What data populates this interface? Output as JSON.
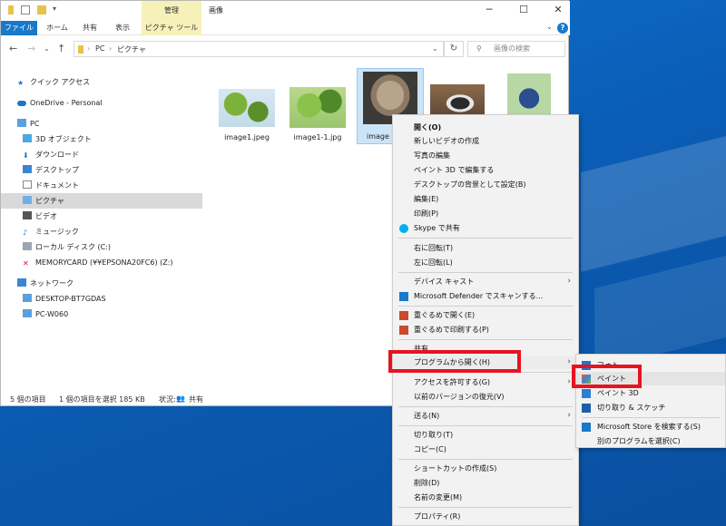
{
  "window": {
    "title": "画像",
    "manage_tab": "管理",
    "picture_tools_tab": "ピクチャ ツール",
    "ribbon_tabs": [
      "ファイル",
      "ホーム",
      "共有",
      "表示"
    ],
    "minimize": "─",
    "maximize": "☐",
    "close": "✕",
    "help": "?"
  },
  "address": {
    "breadcrumbs": [
      "PC",
      "ピクチャ"
    ],
    "search_placeholder": "画像の検索"
  },
  "nav": {
    "quick_access": "クイック アクセス",
    "onedrive": "OneDrive - Personal",
    "pc": "PC",
    "objects3d": "3D オブジェクト",
    "downloads": "ダウンロード",
    "desktop": "デスクトップ",
    "documents": "ドキュメント",
    "pictures": "ピクチャ",
    "videos": "ビデオ",
    "music": "ミュージック",
    "local_disk": "ローカル ディスク (C:)",
    "memorycard": "MEMORYCARD (¥¥EPSONA20FC6) (Z:)",
    "network": "ネットワーク",
    "desktop_pc": "DESKTOP-BT7GDAS",
    "pc_w060": "PC-W060"
  },
  "files": [
    {
      "name": "image1.jpeg"
    },
    {
      "name": "image1-1.jpg"
    },
    {
      "name": "image"
    }
  ],
  "status": {
    "count": "5 個の項目",
    "selected": "1 個の項目を選択  185 KB",
    "state": "状況:",
    "shared": "共有"
  },
  "context_menu": {
    "open": "開く(O)",
    "new_video": "新しいビデオの作成",
    "edit_photo": "写真の編集",
    "paint3d": "ペイント 3D で編集する",
    "set_background": "デスクトップの背景として設定(B)",
    "edit": "編集(E)",
    "print": "印刷(P)",
    "skype": "Skype で共有",
    "rotate_right": "右に回転(T)",
    "rotate_left": "左に回転(L)",
    "cast": "デバイス キャスト",
    "defender": "Microsoft Defender でスキャンする...",
    "gurumeru_open": "重ぐるめで開く(E)",
    "gurumeru_print": "重ぐるめで印刷する(P)",
    "share": "共有",
    "open_with": "プログラムから開く(H)",
    "grant_access": "アクセスを許可する(G)",
    "restore": "以前のバージョンの復元(V)",
    "send_to": "送る(N)",
    "cut": "切り取り(T)",
    "copy": "コピー(C)",
    "create_shortcut": "ショートカットの作成(S)",
    "delete": "削除(D)",
    "rename": "名前の変更(M)",
    "properties": "プロパティ(R)"
  },
  "submenu": {
    "photos": "フォト",
    "paint": "ペイント",
    "paint3d": "ペイント 3D",
    "snip": "切り取り & スケッチ",
    "store": "Microsoft Store を検索する(S)",
    "choose": "別のプログラムを選択(C)"
  },
  "colors": {
    "highlight_red": "#e8131f",
    "accent_blue": "#1979ca",
    "manage_yellow": "#f6f1b9"
  }
}
